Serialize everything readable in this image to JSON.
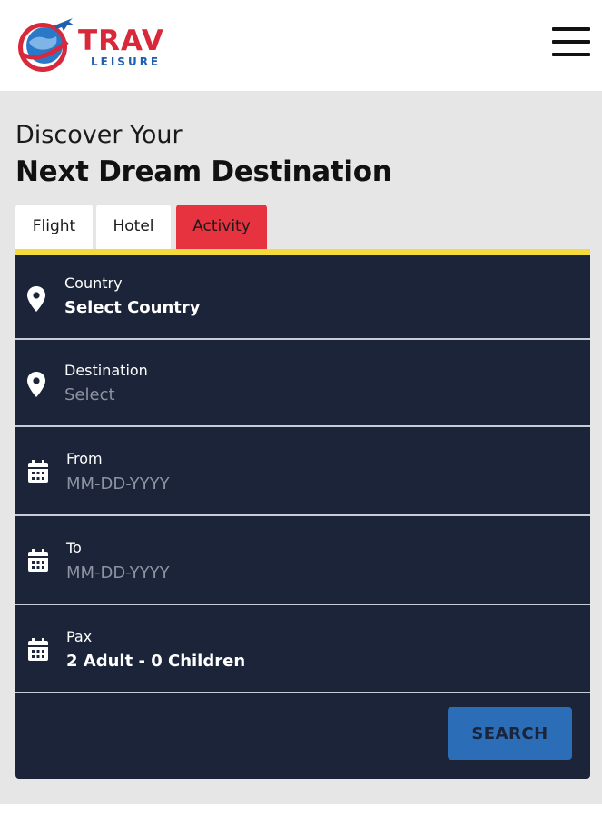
{
  "brand": {
    "name": "TRAV",
    "tagline": "LEISURE"
  },
  "hero": {
    "line1": "Discover Your",
    "line2": "Next Dream Destination"
  },
  "tabs": [
    {
      "label": "Flight",
      "active": false
    },
    {
      "label": "Hotel",
      "active": false
    },
    {
      "label": "Activity",
      "active": true
    }
  ],
  "form": {
    "country": {
      "label": "Country",
      "value": "Select Country",
      "icon": "map-pin-icon"
    },
    "destination": {
      "label": "Destination",
      "placeholder": "Select",
      "icon": "map-pin-icon"
    },
    "from": {
      "label": "From",
      "placeholder": "MM-DD-YYYY",
      "icon": "calendar-icon"
    },
    "to": {
      "label": "To",
      "placeholder": "MM-DD-YYYY",
      "icon": "calendar-icon"
    },
    "pax": {
      "label": "Pax",
      "value": "2 Adult - 0 Children",
      "icon": "calendar-icon"
    },
    "search_label": "SEARCH"
  },
  "colors": {
    "accent_red": "#e7323f",
    "form_bg": "#1b2438",
    "accent_yellow": "#f4da3c",
    "button_blue": "#2b6db6",
    "brand_blue": "#1f5fae"
  }
}
